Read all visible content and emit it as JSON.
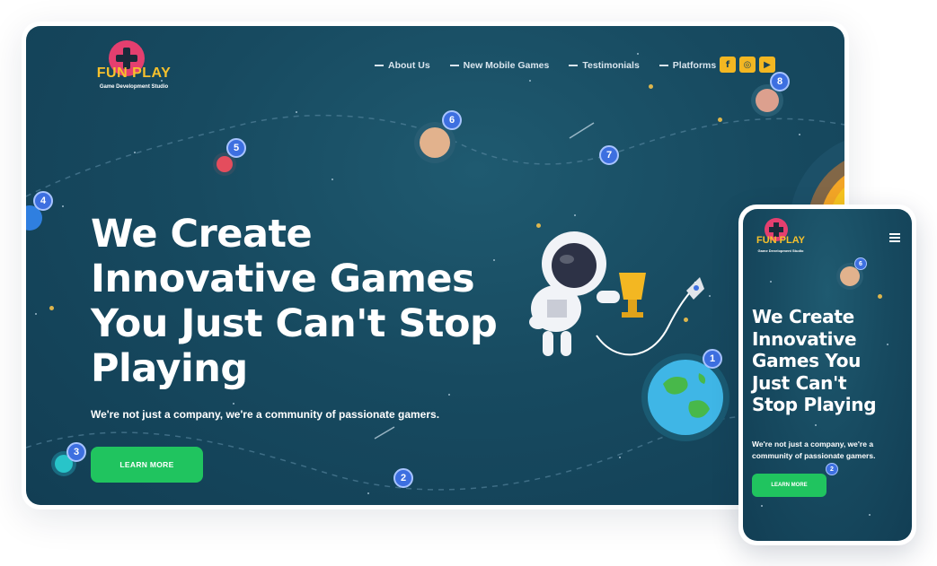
{
  "brand": {
    "name": "FUN PLAY",
    "tagline": "Game Development Studio"
  },
  "nav": [
    {
      "label": "About Us"
    },
    {
      "label": "New Mobile Games"
    },
    {
      "label": "Testimonials"
    },
    {
      "label": "Platforms"
    }
  ],
  "socials": [
    {
      "name": "facebook-icon",
      "glyph": "f"
    },
    {
      "name": "instagram-icon",
      "glyph": "◎"
    },
    {
      "name": "youtube-icon",
      "glyph": "▶"
    }
  ],
  "hero": {
    "title_lines": [
      "We Create",
      "Innovative Games",
      "You Just Can't Stop",
      "Playing"
    ],
    "subtitle": "We're not just a company, we're a community of passionate gamers.",
    "cta": "LEARN MORE"
  },
  "markers": [
    "1",
    "2",
    "3",
    "4",
    "5",
    "6",
    "7",
    "8"
  ],
  "mobile": {
    "title_lines": [
      "We Create",
      "Innovative",
      "Games You",
      "Just Can't",
      "Stop Playing"
    ],
    "subtitle_lines": [
      "We're not just a company, we're a",
      "community of passionate gamers."
    ],
    "cta": "LEARN MORE",
    "markers": [
      "6",
      "2"
    ]
  },
  "colors": {
    "accent": "#20c45f",
    "brand_yellow": "#f6c12d",
    "marker_blue": "#3d6fe0",
    "bg": "#174a60"
  }
}
